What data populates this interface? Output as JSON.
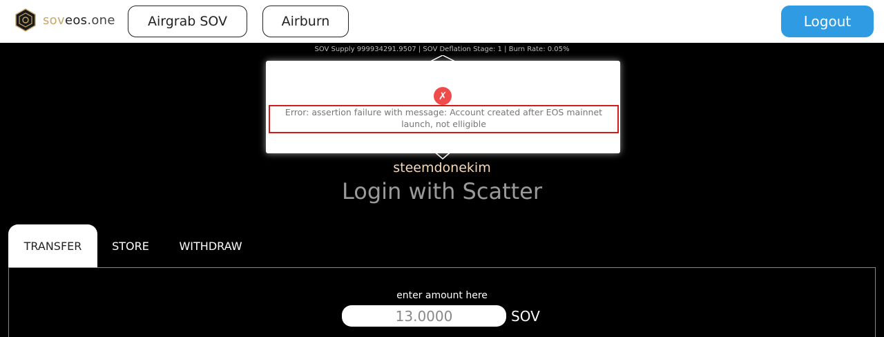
{
  "header": {
    "logo": {
      "part1": "sov",
      "part2": "eos",
      "part3": ".one"
    },
    "nav": {
      "airgrab_label": "Airgrab SOV",
      "airburn_label": "Airburn"
    },
    "logout_label": "Logout",
    "colors": {
      "brand_gold": "#c8a66a",
      "logout_blue": "#2e9be3"
    }
  },
  "supply_info": "SOV Supply 999934291.9507 | SOV Deflation Stage: 1 | Burn Rate: 0.05%",
  "account": {
    "username": "steemdonekim",
    "login_title": "Login with Scatter"
  },
  "tabs": [
    {
      "label": "TRANSFER",
      "active": true
    },
    {
      "label": "STORE",
      "active": false
    },
    {
      "label": "WITHDRAW",
      "active": false
    }
  ],
  "transfer": {
    "amount_label": "enter amount here",
    "amount_value": "13.0000",
    "unit": "SOV"
  },
  "modal": {
    "icon": "error-x-icon",
    "icon_glyph": "✗",
    "error_message": "Error: assertion failure with message: Account created after EOS mainnet launch, not elligible",
    "colors": {
      "icon_bg": "#f04b4b",
      "highlight_border": "#d61a1a"
    }
  }
}
